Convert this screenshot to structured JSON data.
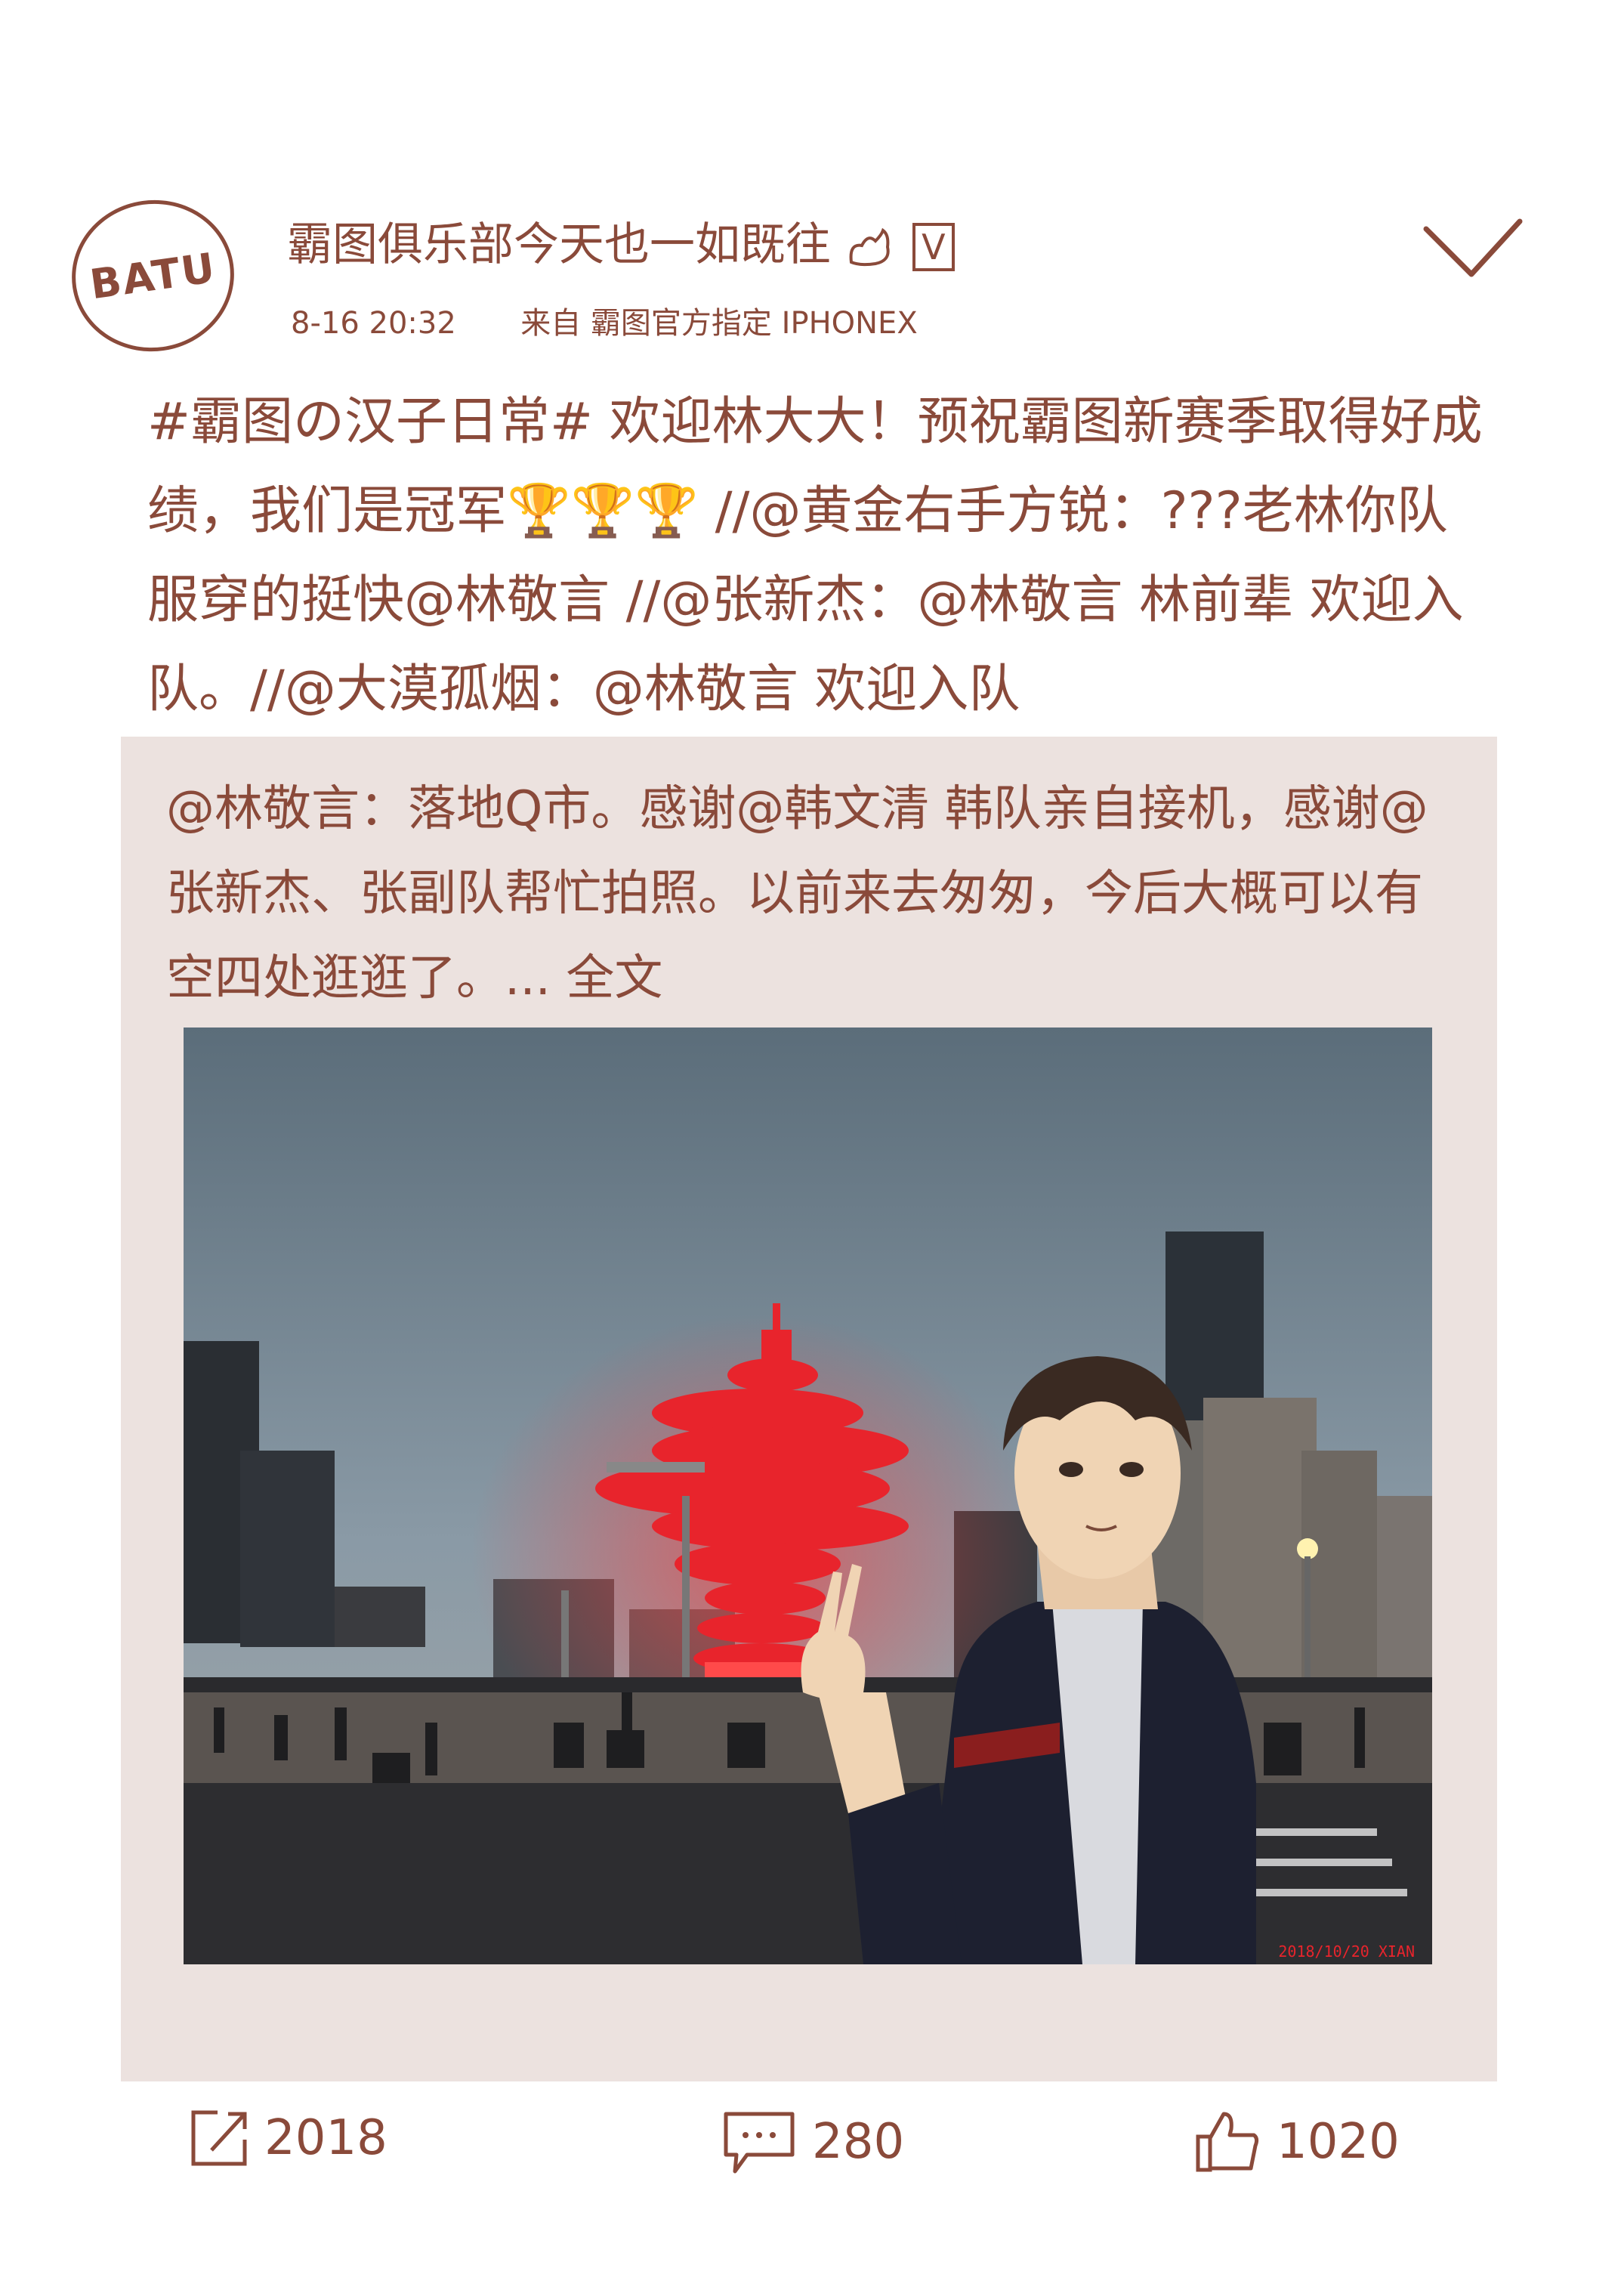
{
  "header": {
    "avatar_text": "BATU",
    "username": "霸图俱乐部今天也一如既往",
    "username_suffix": "V",
    "time": "8-16  20:32",
    "source": "来自 霸图官方指定 IPHONEX"
  },
  "post": {
    "text": "#霸图の汉子日常# 欢迎林大大！预祝霸图新赛季取得好成绩，我们是冠军🏆🏆🏆 //@黄金右手方锐：???老林你队服穿的挺快@林敬言 //@张新杰：@林敬言 林前辈 欢迎入队。//@大漠孤烟：@林敬言 欢迎入队"
  },
  "repost": {
    "text": "@林敬言：落地Q市。感谢@韩文清 韩队亲自接机，感谢@张新杰、张副队帮忙拍照。以前来去匆匆，今后大概可以有空四处逛逛了。... 全文",
    "photo_stamp": "2018/10/20 XIAN"
  },
  "actions": {
    "share_count": "2018",
    "comment_count": "280",
    "like_count": "1020"
  },
  "colors": {
    "ink": "#8a4a3a",
    "card_bg": "#ece2df",
    "sculpture": "#e8242c"
  }
}
